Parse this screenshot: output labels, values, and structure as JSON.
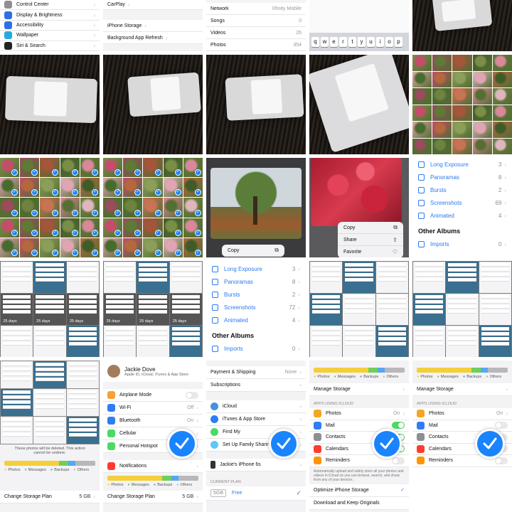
{
  "tiles": {
    "settings_top": {
      "items": [
        "Control Center",
        "Display & Brightness",
        "Accessibility",
        "Wallpaper",
        "Siri & Search"
      ],
      "colors": [
        "#8e8e93",
        "#2f6fe4",
        "#2f6fe4",
        "#29a9df",
        "#222"
      ]
    },
    "carplay": {
      "items": [
        "CarPlay",
        "iPhone Storage",
        "Background App Refresh"
      ]
    },
    "network": {
      "rows": [
        {
          "label": "Network",
          "value": "Xfinity Mobile"
        },
        {
          "label": "Songs",
          "value": "0"
        },
        {
          "label": "Videos",
          "value": "26"
        },
        {
          "label": "Photos",
          "value": "354"
        }
      ]
    },
    "keyboard": {
      "keys": [
        "q",
        "w",
        "e",
        "r",
        "t",
        "y",
        "u",
        "i",
        "o",
        "p"
      ]
    },
    "copy_menu_tree": {
      "items": [
        {
          "label": "Copy",
          "icon": "copy-icon"
        }
      ]
    },
    "copy_menu_leaves": {
      "items": [
        {
          "label": "Copy",
          "icon": "copy-icon"
        },
        {
          "label": "Share",
          "icon": "share-icon"
        },
        {
          "label": "Favorite",
          "icon": "heart-icon"
        }
      ]
    },
    "albums_a": {
      "rows": [
        {
          "label": "Long Exposure",
          "count": "3"
        },
        {
          "label": "Panoramas",
          "count": "8"
        },
        {
          "label": "Bursts",
          "count": "2"
        },
        {
          "label": "Screenshots",
          "count": "69"
        },
        {
          "label": "Animated",
          "count": "4"
        }
      ],
      "other_albums": "Other Albums",
      "imports": {
        "label": "Imports",
        "count": "0"
      }
    },
    "albums_b": {
      "rows": [
        {
          "label": "Long Exposure",
          "count": "3"
        },
        {
          "label": "Panoramas",
          "count": "8"
        },
        {
          "label": "Bursts",
          "count": "2"
        },
        {
          "label": "Screenshots",
          "count": "72"
        },
        {
          "label": "Animated",
          "count": "4"
        }
      ],
      "other_albums": "Other Albums",
      "imports": {
        "label": "Imports",
        "count": "0"
      }
    },
    "days_label": "25 days",
    "storage_alert": {
      "warning": "These photos will be deleted. This action cannot be undone.",
      "legend": [
        "Photos",
        "Messages",
        "Backups",
        "Others"
      ],
      "plan_label": "Change Storage Plan",
      "plan_value": "5 GB"
    },
    "account": {
      "name": "Jackie Dove",
      "subtitle": "Apple ID, iCloud, iTunes & App Store",
      "rows": [
        {
          "label": "Airplane Mode",
          "value": "",
          "color": "#f7a035"
        },
        {
          "label": "Wi-Fi",
          "value": "Off",
          "color": "#2f7df5"
        },
        {
          "label": "Bluetooth",
          "value": "On",
          "color": "#2f7df5"
        },
        {
          "label": "Cellular",
          "value": "",
          "color": "#4cd964"
        },
        {
          "label": "Personal Hotspot",
          "value": "",
          "color": "#4cd964"
        }
      ],
      "notifications": "Notifications",
      "legend": [
        "Photos",
        "Messages",
        "Backups",
        "Others"
      ],
      "plan_label": "Change Storage Plan",
      "plan_value": "5 GB"
    },
    "icloud_account": {
      "rows_top": [
        {
          "label": "Payment & Shipping",
          "value": "None"
        },
        {
          "label": "Subscriptions",
          "value": ""
        }
      ],
      "rows_services": [
        {
          "label": "iCloud",
          "color": "#4a90e2"
        },
        {
          "label": "iTunes & App Store",
          "color": "#2f7df5"
        },
        {
          "label": "Find My",
          "color": "#4cd964"
        },
        {
          "label": "Set Up Family Sharing",
          "color": "#5ac8fa"
        }
      ],
      "device": "Jackie's iPhone 6s",
      "current_plan": "CURRENT PLAN",
      "plan_size": "5GB",
      "plan_price": "Free"
    },
    "icloud_apps_a": {
      "legend": [
        "Photos",
        "Messages",
        "Backups",
        "Others"
      ],
      "manage": "Manage Storage",
      "section": "APPS USING ICLOUD",
      "apps": [
        {
          "label": "Photos",
          "value": "On",
          "toggle": false,
          "color": "#f5a623"
        },
        {
          "label": "Mail",
          "value": "",
          "toggle": true,
          "color": "#2f7df5"
        },
        {
          "label": "Contacts",
          "value": "",
          "toggle": true,
          "color": "#8e8e93"
        },
        {
          "label": "Calendars",
          "value": "",
          "toggle": true,
          "color": "#ff3b30"
        },
        {
          "label": "Reminders",
          "value": "",
          "toggle": false,
          "color": "#ff9500"
        }
      ],
      "note": "Automatically upload and safely store all your photos and videos in iCloud so you can browse, search, and share from any of your devices.",
      "optimize": "Optimize iPhone Storage",
      "download": "Download and Keep Originals"
    },
    "icloud_apps_b": {
      "legend": [
        "Photos",
        "Messages",
        "Backups",
        "Others"
      ],
      "manage": "Manage Storage",
      "section": "APPS USING ICLOUD",
      "apps": [
        {
          "label": "Photos",
          "value": "On",
          "color": "#f5a623"
        },
        {
          "label": "Mail",
          "value": "",
          "color": "#2f7df5"
        },
        {
          "label": "Contacts",
          "value": "",
          "color": "#8e8e93"
        },
        {
          "label": "Calendars",
          "value": "",
          "color": "#ff3b30"
        },
        {
          "label": "Reminders",
          "value": "",
          "color": "#ff9500"
        }
      ]
    }
  },
  "colors": {
    "accent": "#1a84ff",
    "bar_photos": "#f4cf3a",
    "bar_messages": "#6fcf5b",
    "bar_backups": "#56a8ef",
    "bar_others": "#b8b8bc"
  }
}
